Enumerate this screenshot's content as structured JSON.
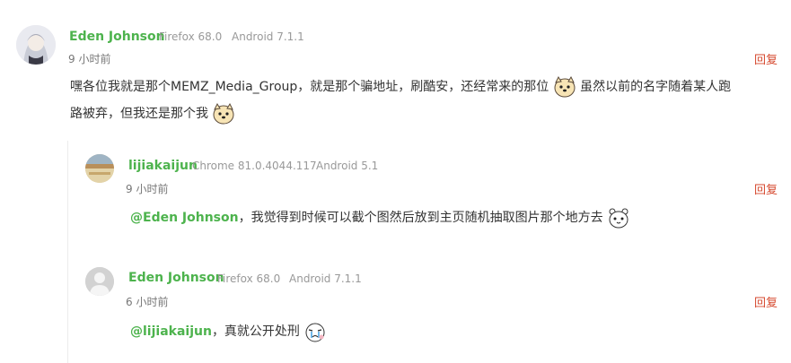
{
  "comments": [
    {
      "author": "Eden Johnson",
      "browser": "Firefox 68.0",
      "os": "Android 7.1.1",
      "time": "9 小时前",
      "reply_label": "回复",
      "text_line1a": "嘿各位我就是那个MEMZ_Media_Group，就是那个骗地址，刷酷安，还经常来的那位",
      "text_line1b": "虽然以前的名字随着某人跑",
      "text_line2": "路被弃，但我还是那个我",
      "emoji": "dog-face-icon"
    },
    {
      "author": "lijiakaijun",
      "browser": "Chrome 81.0.4044.117",
      "os": "Android 5.1",
      "time": "9 小时前",
      "reply_label": "回复",
      "mention": "@Eden Johnson",
      "text": "，我觉得到时候可以截个图然后放到主页随机抽取图片那个地方去",
      "emoji": "bear-face-icon"
    },
    {
      "author": "Eden Johnson",
      "browser": "Firefox 68.0",
      "os": "Android 7.1.1",
      "time": "6 小时前",
      "reply_label": "回复",
      "mention": "@lijiakaijun",
      "text": "，真就公开处刑",
      "emoji": "tearful-face-icon"
    }
  ],
  "colors": {
    "author": "#4db34d",
    "reply": "#d6492f",
    "meta": "#999999"
  }
}
